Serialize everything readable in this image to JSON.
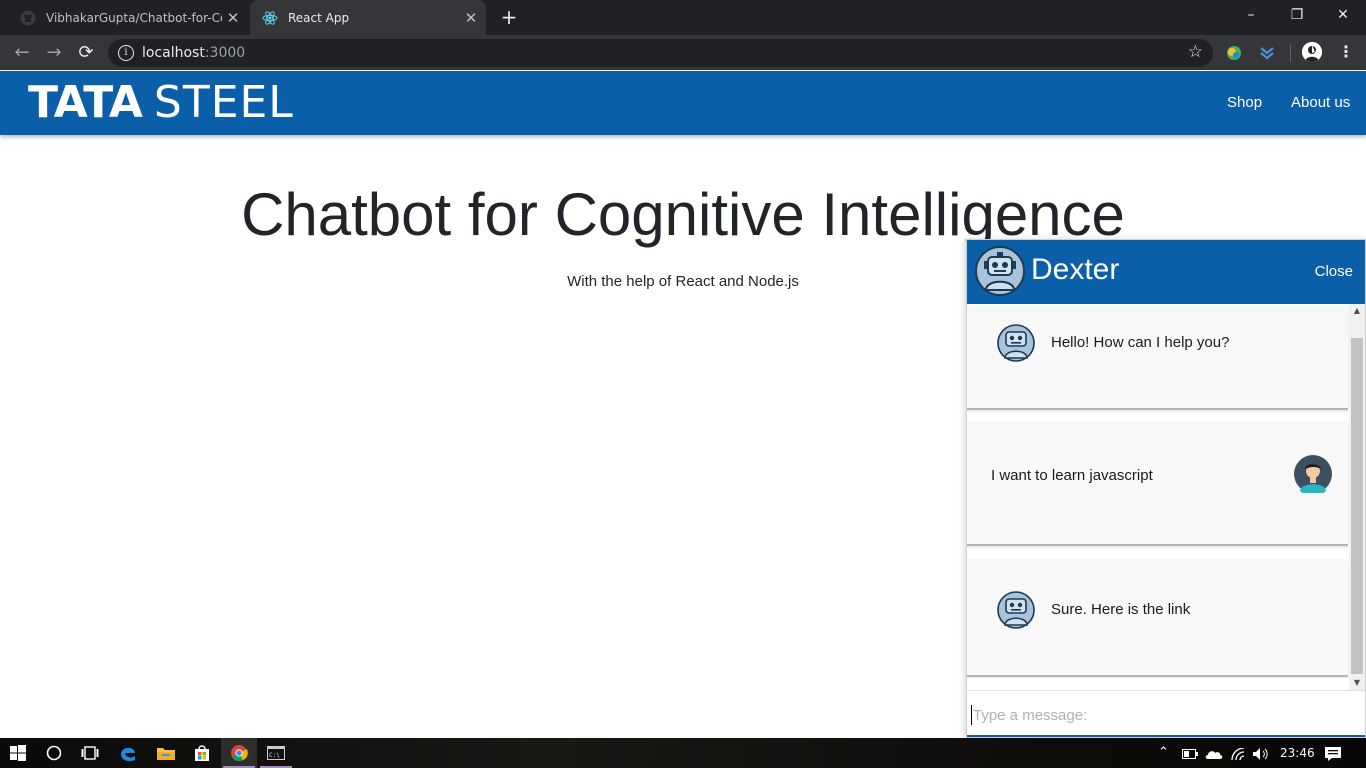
{
  "browser": {
    "tabs": [
      {
        "title": "VibhakarGupta/Chatbot-for-Cog",
        "favicon": "github-icon",
        "active": false
      },
      {
        "title": "React App",
        "favicon": "react-icon",
        "active": true
      }
    ],
    "new_tab": "+",
    "url_host": "localhost",
    "url_port": ":3000",
    "window_controls": {
      "minimize": "–",
      "restore": "❐",
      "close": "✕"
    }
  },
  "header": {
    "brand_word1": "TATA",
    "brand_word2": "STEEL",
    "nav": [
      "Shop",
      "About us"
    ],
    "bg_color": "#0b5ea8"
  },
  "main": {
    "title": "Chatbot for Cognitive Intelligence",
    "subtitle": "With the help of React and Node.js"
  },
  "chat": {
    "bot_name": "Dexter",
    "close_label": "Close",
    "messages": [
      {
        "from": "bot",
        "text": "Hello! How can I help you?"
      },
      {
        "from": "user",
        "text": "I want to learn javascript"
      },
      {
        "from": "bot",
        "text": "Sure. Here is the link"
      }
    ],
    "input_placeholder": "Type a message:"
  },
  "taskbar": {
    "time": "23:46"
  }
}
